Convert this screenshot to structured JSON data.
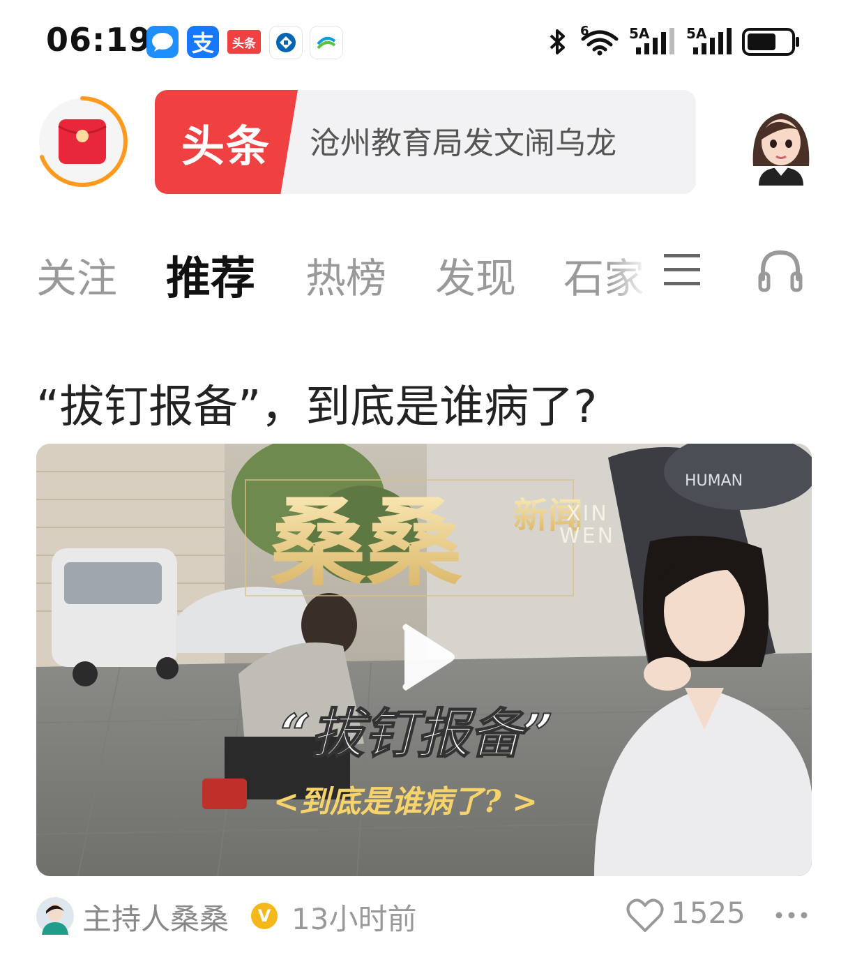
{
  "status_bar": {
    "time": "06:19",
    "apps": [
      {
        "icon": "message-bubble-icon",
        "color": "#1f8fff"
      },
      {
        "label": "支",
        "icon": "alipay-icon",
        "color": "#1677ff"
      },
      {
        "label": "头条",
        "icon": "toutiao-icon",
        "color": "#f04142"
      },
      {
        "icon": "ccb-bank-icon",
        "color": "#0066b3"
      },
      {
        "icon": "china-mobile-icon",
        "color": "#0b9de0"
      }
    ],
    "signal_6_label": "6",
    "sim1_label": "5A",
    "sim2_label": "5A"
  },
  "header": {
    "brand_label": "头条",
    "search_text": "沧州教育局发文闹乌龙"
  },
  "tabs": [
    {
      "label": "关注",
      "active": false
    },
    {
      "label": "推荐",
      "active": true
    },
    {
      "label": "热榜",
      "active": false
    },
    {
      "label": "发现",
      "active": false
    },
    {
      "label": "石家",
      "active": false
    }
  ],
  "article": {
    "title": "“拔钉报备”，到底是谁病了?",
    "thumbnail": {
      "brand_big": "桑桑",
      "brand_small": "新闻",
      "brand_latin_1": "XIN",
      "brand_latin_2": "WEN",
      "overlay_title": "“拔钉报备”",
      "overlay_subtitle": "<到底是谁病了? >",
      "cap_text": "HUMAN"
    },
    "author": "主持人桑桑",
    "verified_badge": "V",
    "time_ago": "13小时前",
    "likes": "1525"
  },
  "colors": {
    "brand_red": "#f04142",
    "redpack_ring": "#ff9a1f",
    "verified_gold": "#f5b81b"
  }
}
